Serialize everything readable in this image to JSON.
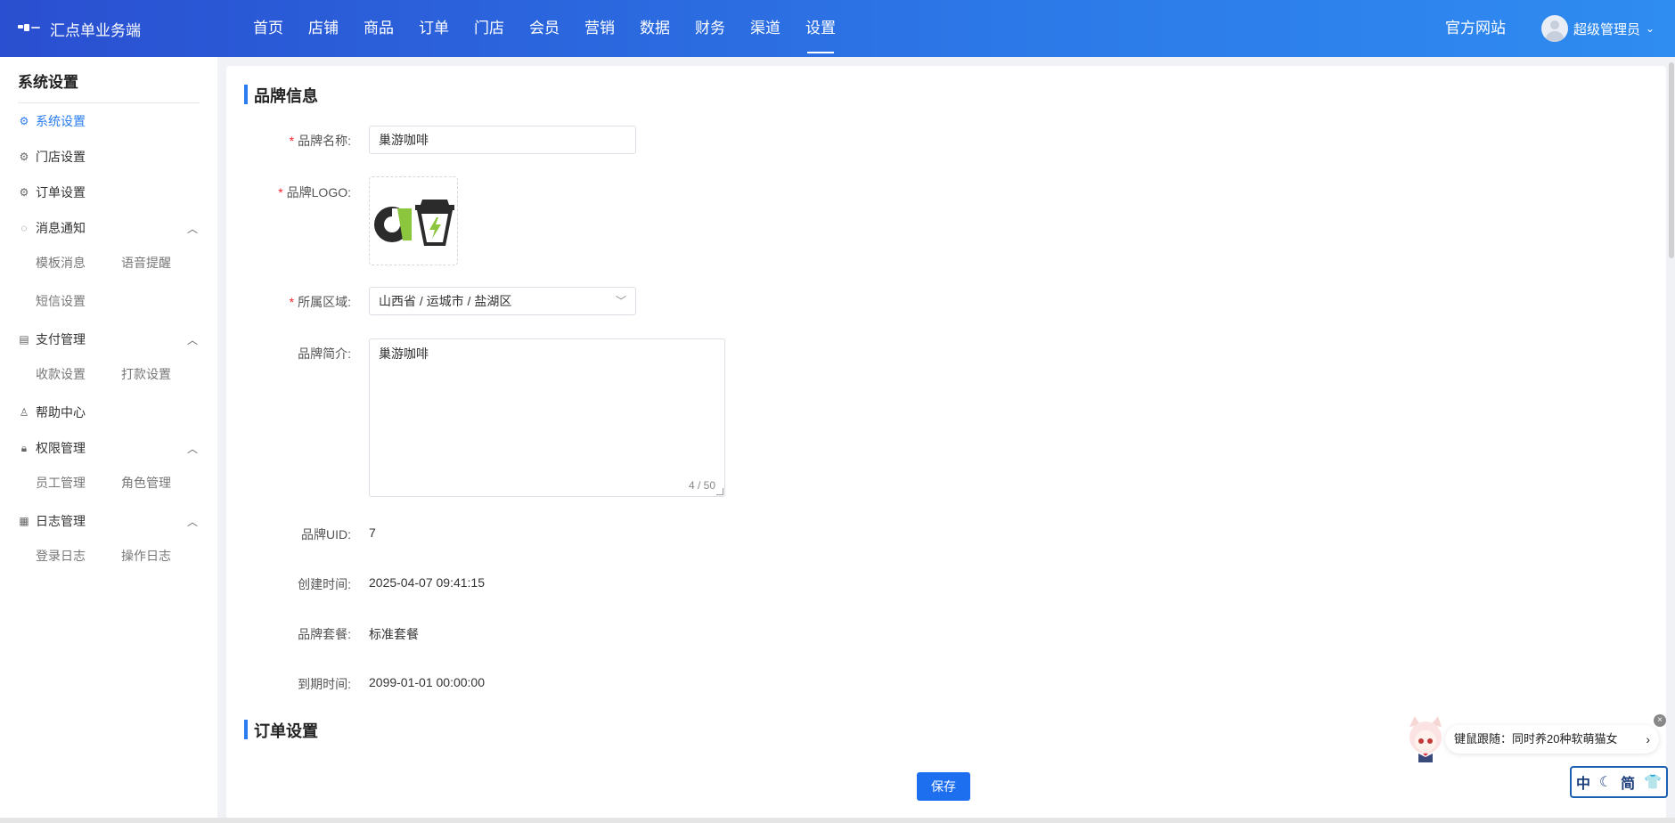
{
  "topbar": {
    "brand_title": "汇点单业务端",
    "nav": [
      "首页",
      "店铺",
      "商品",
      "订单",
      "门店",
      "会员",
      "营销",
      "数据",
      "财务",
      "渠道",
      "设置"
    ],
    "active_nav": "设置",
    "official_site": "官方网站",
    "user_name": "超级管理员",
    "user_caret": "⌄"
  },
  "sidebar": {
    "title": "系统设置",
    "menu": {
      "system": "系统设置",
      "store": "门店设置",
      "order": "订单设置",
      "message": "消息通知",
      "message_sub": [
        "模板消息",
        "语音提醒",
        "短信设置"
      ],
      "payment": "支付管理",
      "payment_sub": [
        "收款设置",
        "打款设置"
      ],
      "help": "帮助中心",
      "permission": "权限管理",
      "permission_sub": [
        "员工管理",
        "角色管理"
      ],
      "log": "日志管理",
      "log_sub": [
        "登录日志",
        "操作日志"
      ]
    }
  },
  "brand_section": {
    "title": "品牌信息",
    "name_label": "品牌名称:",
    "name_value": "巢游咖啡",
    "logo_label": "品牌LOGO:",
    "region_label": "所属区域:",
    "region_value": "山西省 / 运城市 / 盐湖区",
    "intro_label": "品牌简介:",
    "intro_value": "巢游咖啡",
    "intro_counter": "4 / 50",
    "uid_label": "品牌UID:",
    "uid_value": "7",
    "created_label": "创建时间:",
    "created_value": "2025-04-07 09:41:15",
    "package_label": "品牌套餐:",
    "package_value": "标准套餐",
    "expire_label": "到期时间:",
    "expire_value": "2099-01-01 00:00:00"
  },
  "order_section": {
    "title": "订单设置"
  },
  "actions": {
    "save": "保存"
  },
  "widgets": {
    "mascot_text": "键鼠跟随：同时养20种软萌猫女",
    "mascot_go": "›",
    "mascot_close": "×",
    "ime": [
      "中",
      "☾",
      "简",
      "👕"
    ]
  },
  "colors": {
    "accent": "#2a7cf0",
    "required": "#f5222d",
    "logo_green": "#8cc63f",
    "logo_dark": "#2b2b2b"
  }
}
